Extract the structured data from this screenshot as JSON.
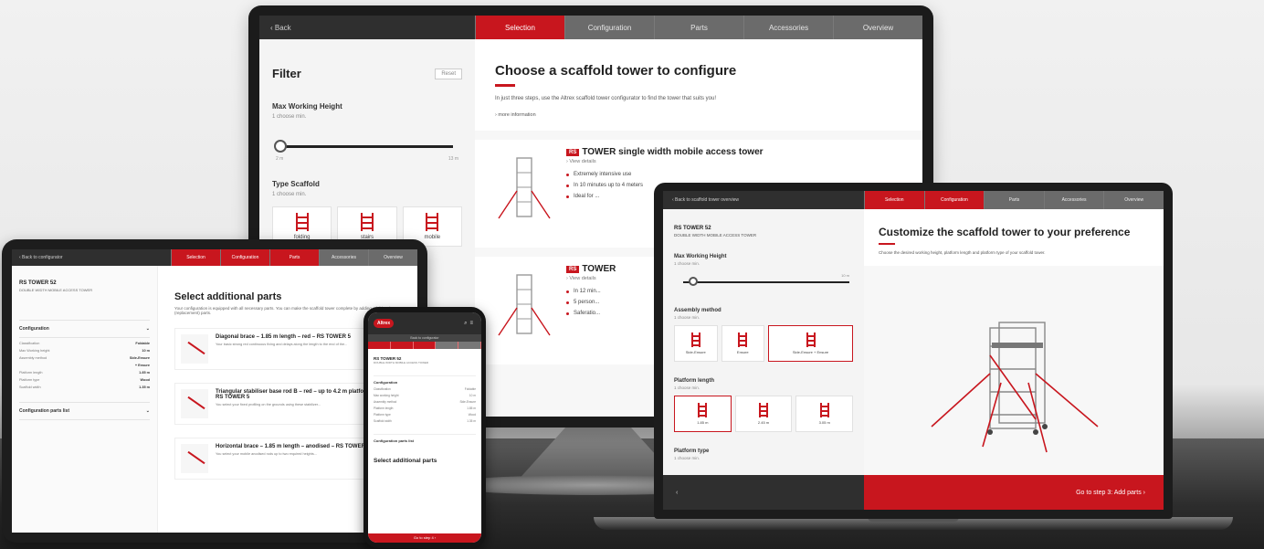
{
  "monitor": {
    "nav": {
      "back": "‹ Back",
      "steps": [
        "Selection",
        "Configuration",
        "Parts",
        "Accessories",
        "Overview"
      ]
    },
    "filter": {
      "title": "Filter",
      "reset": "Reset",
      "max_height_label": "Max Working Height",
      "max_height_sub": "1 choose min.",
      "slider_min": "2 m",
      "slider_max": "13 m",
      "type_label": "Type Scaffold",
      "type_sub": "1 choose min.",
      "types": [
        "folding",
        "stairs",
        "mobile"
      ]
    },
    "main": {
      "title": "Choose a scaffold tower to configure",
      "subtitle": "In just three steps, use the Altrex scaffold tower configurator to find the tower that suits you!",
      "more_info": "› more information",
      "products": [
        {
          "logo": "RS",
          "name": "TOWER  single width mobile access tower",
          "view": "› View details",
          "bullets": [
            "Extremely intensive use",
            "In 10 minutes up to 4 meters",
            "Ideal for ..."
          ]
        },
        {
          "logo": "RS",
          "name": "TOWER",
          "view": "› View details",
          "bullets": [
            "In 12 min...",
            "5 person...",
            "Saferatio..."
          ]
        }
      ]
    }
  },
  "tablet": {
    "nav": {
      "back": "‹ Back to configurator",
      "steps": [
        "Selection",
        "Configuration",
        "Parts",
        "Accessories",
        "Overview"
      ]
    },
    "side": {
      "brand": "RS TOWER 52",
      "brand_sub": "DOUBLE WIDTH MOBILE ACCESS TOWER",
      "section": "Configuration",
      "rows": [
        {
          "k": "Classification",
          "v": "Foldable"
        },
        {
          "k": "Max Working height",
          "v": "10 m"
        },
        {
          "k": "Assembly method",
          "v": "Side-Ensure"
        },
        {
          "k": "",
          "v": "+ Ensure"
        },
        {
          "k": "Platform length",
          "v": "1.85 m"
        },
        {
          "k": "Platform type",
          "v": "Wood"
        },
        {
          "k": "Scaffold width",
          "v": "1.35 m"
        }
      ],
      "parts_list": "Configuration parts list"
    },
    "main": {
      "title": "Select additional parts",
      "subtitle": "Your configuration is equipped with all necessary parts. You can make the scaffold tower complete by adding additional (replacement) parts.",
      "parts": [
        {
          "title": "Diagonal brace – 1.85 m length – red – RS TOWER 5",
          "desc": "Your basic strong red continuous fixing and delays along the length to the end of the..."
        },
        {
          "title": "Triangular stabiliser base rod B – red – up to 4.2 m platform height – RS TOWER 5",
          "desc": "You select your fixed profiling on the grounds using these stabilizer..."
        },
        {
          "title": "Horizontal brace – 1.85 m length – anodised – RS TOWER 4 & 5",
          "desc": "You select your mobile anodised rods up to two required heights..."
        }
      ]
    }
  },
  "phone": {
    "logo": "Altrex",
    "back": "Back to configurator",
    "brand": "RS TOWER 52",
    "brand_sub": "DOUBLE WIDTH MOBILE ACCESS TOWER",
    "section": "Configuration",
    "rows": [
      {
        "k": "Classification",
        "v": "Foldable"
      },
      {
        "k": "Max working height",
        "v": "10 m"
      },
      {
        "k": "Assembly method",
        "v": "Side-Ensure"
      },
      {
        "k": "Platform length",
        "v": "1.85 m"
      },
      {
        "k": "Platform type",
        "v": "Wood"
      },
      {
        "k": "Scaffold width",
        "v": "1.35 m"
      }
    ],
    "parts_list": "Configuration parts list",
    "title": "Select additional parts",
    "footer": "Go to step 4 ›"
  },
  "laptop": {
    "nav": {
      "back": "‹ Back to scaffold tower overview",
      "steps": [
        "Selection",
        "Configuration",
        "Parts",
        "Accessories",
        "Overview"
      ]
    },
    "side": {
      "brand": "RS TOWER 52",
      "brand_sub": "DOUBLE WIDTH MOBILE ACCESS TOWER",
      "height_label": "Max Working Height",
      "height_sub": "1 choose min.",
      "height_val": "10 m",
      "assembly_label": "Assembly method",
      "assembly_sub": "1 choose min.",
      "assembly": [
        "Side-Ensure",
        "Ensure",
        "Side-Ensure + Ensure"
      ],
      "length_label": "Platform length",
      "length_sub": "1 choose min.",
      "lengths": [
        "1.85 m",
        "2.45 m",
        "3.05 m"
      ],
      "ptype_label": "Platform type",
      "ptype_sub": "1 choose min."
    },
    "main": {
      "title": "Customize the scaffold tower to your preference",
      "subtitle": "Choose the desired working height, platform length and platform type of your scaffold tower."
    },
    "footer": {
      "left": "‹",
      "cta": "Go to step 3: Add parts ›"
    }
  }
}
